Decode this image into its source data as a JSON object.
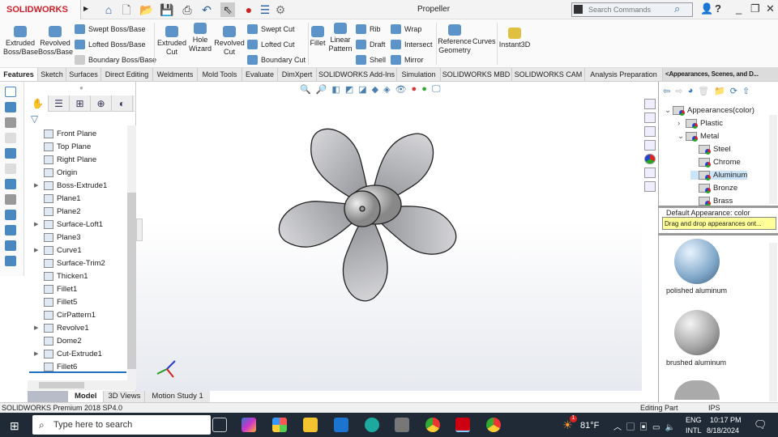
{
  "app": {
    "logo": "SOLIDWORKS",
    "title": "Propeller",
    "search_placeholder": "Search Commands"
  },
  "command_manager": {
    "large": [
      {
        "label": "Extruded\nBoss/Base"
      },
      {
        "label": "Revolved\nBoss/Base"
      },
      {
        "label": "Extruded\nCut"
      },
      {
        "label": "Hole\nWizard"
      },
      {
        "label": "Revolved\nCut"
      },
      {
        "label": "Fillet"
      },
      {
        "label": "Linear\nPattern"
      },
      {
        "label": "Reference\nGeometry"
      },
      {
        "label": "Curves"
      },
      {
        "label": "Instant3D"
      }
    ],
    "small": [
      "Swept Boss/Base",
      "Lofted Boss/Base",
      "Boundary Boss/Base",
      "Swept Cut",
      "Lofted Cut",
      "Boundary Cut",
      "Rib",
      "Draft",
      "Shell",
      "Wrap",
      "Intersect",
      "Mirror"
    ]
  },
  "tabs": [
    "Features",
    "Sketch",
    "Surfaces",
    "Direct Editing",
    "Weldments",
    "Mold Tools",
    "Evaluate",
    "DimXpert",
    "SOLIDWORKS Add-Ins",
    "Simulation",
    "SOLIDWORKS MBD",
    "SOLIDWORKS CAM",
    "Analysis Preparation",
    "<Appearances, Scenes, and D..."
  ],
  "feature_tree": [
    "Front Plane",
    "Top Plane",
    "Right Plane",
    "Origin",
    "Boss-Extrude1",
    "Plane1",
    "Plane2",
    "Surface-Loft1",
    "Plane3",
    "Curve1",
    "Surface-Trim2",
    "Thicken1",
    "Fillet1",
    "Fillet5",
    "CirPattern1",
    "Revolve1",
    "Dome2",
    "Cut-Extrude1",
    "Fillet6"
  ],
  "bottom_tabs": [
    "Model",
    "3D Views",
    "Motion Study 1"
  ],
  "task_pane": {
    "tree": [
      "Appearances(color)",
      "Plastic",
      "Metal",
      "Steel",
      "Chrome",
      "Aluminum",
      "Bronze",
      "Brass"
    ],
    "default": "Default Appearance: color",
    "tooltip": "Drag and drop appearances ont...",
    "swatches": [
      "polished aluminum",
      "brushed aluminum"
    ]
  },
  "status": {
    "product": "SOLIDWORKS Premium 2018 SP4.0",
    "mode": "Editing Part",
    "units": "IPS"
  },
  "taskbar": {
    "search": "Type here to search",
    "temp": "81°F",
    "lang1": "ENG",
    "lang2": "INTL",
    "time": "10:17 PM",
    "date": "8/18/2024",
    "badge": "1"
  }
}
